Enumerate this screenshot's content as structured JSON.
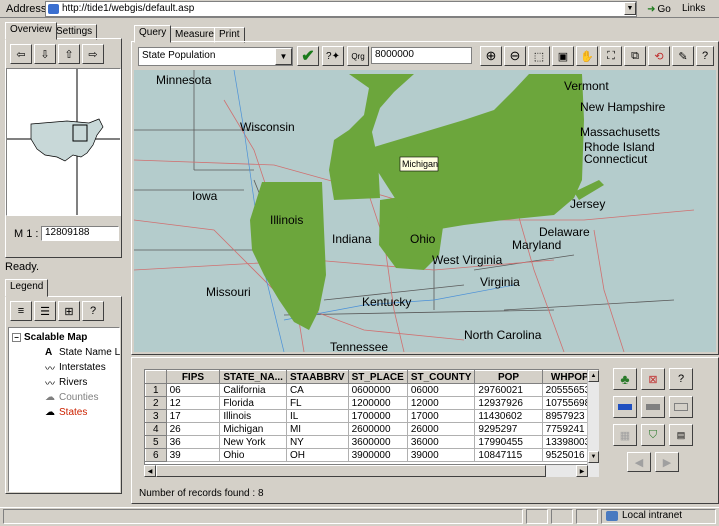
{
  "browser": {
    "address_label": "Address",
    "url": "http://tide1/webgis/default.asp",
    "go_label": "Go",
    "links_label": "Links"
  },
  "left": {
    "tabs": [
      "Overview",
      "Settings"
    ],
    "scale_label": "M 1 :",
    "scale_value": "12809188",
    "status": "Ready.",
    "legend_tab": "Legend",
    "legend_title": "Scalable Map",
    "legend_items": [
      {
        "label": "State Name L",
        "color": "#000000"
      },
      {
        "label": "Interstates",
        "color": "#000000"
      },
      {
        "label": "Rivers",
        "color": "#000000"
      },
      {
        "label": "Counties",
        "color": "#808080"
      },
      {
        "label": "States",
        "color": "#cc2200"
      }
    ]
  },
  "main": {
    "tabs": [
      "Query",
      "Measure",
      "Print"
    ],
    "layer_select": "State Population",
    "query_btn": "Qrg",
    "query_value": "8000000",
    "tooltip": "Michigan",
    "highlight_color": "#6ca63c",
    "map_labels": [
      "Minnesota",
      "Wisconsin",
      "Iowa",
      "Illinois",
      "Indiana",
      "Missouri",
      "Kentucky",
      "Tennessee",
      "Ohio",
      "West Virginia",
      "Virginia",
      "North Carolina",
      "Maryland",
      "Delaware",
      "Jersey",
      "Vermont",
      "New Hampshire",
      "Massachusetts",
      "Rhode Island",
      "Connecticut"
    ]
  },
  "grid": {
    "columns": [
      "FIPS",
      "STATE_NA...",
      "STAABBRV",
      "ST_PLACE",
      "ST_COUNTY",
      "POP",
      "WHPOP"
    ],
    "rows": [
      [
        "1",
        "06",
        "California",
        "CA",
        "0600000",
        "06000",
        "29760021",
        "20555653"
      ],
      [
        "2",
        "12",
        "Florida",
        "FL",
        "1200000",
        "12000",
        "12937926",
        "10755698"
      ],
      [
        "3",
        "17",
        "Illinois",
        "IL",
        "1700000",
        "17000",
        "11430602",
        "8957923"
      ],
      [
        "4",
        "26",
        "Michigan",
        "MI",
        "2600000",
        "26000",
        "9295297",
        "7759241"
      ],
      [
        "5",
        "36",
        "New York",
        "NY",
        "3600000",
        "36000",
        "17990455",
        "13398003"
      ],
      [
        "6",
        "39",
        "Ohio",
        "OH",
        "3900000",
        "39000",
        "10847115",
        "9525016"
      ]
    ],
    "records_label": "Number of records found : 8"
  },
  "statusbar": {
    "zone": "Local intranet"
  }
}
